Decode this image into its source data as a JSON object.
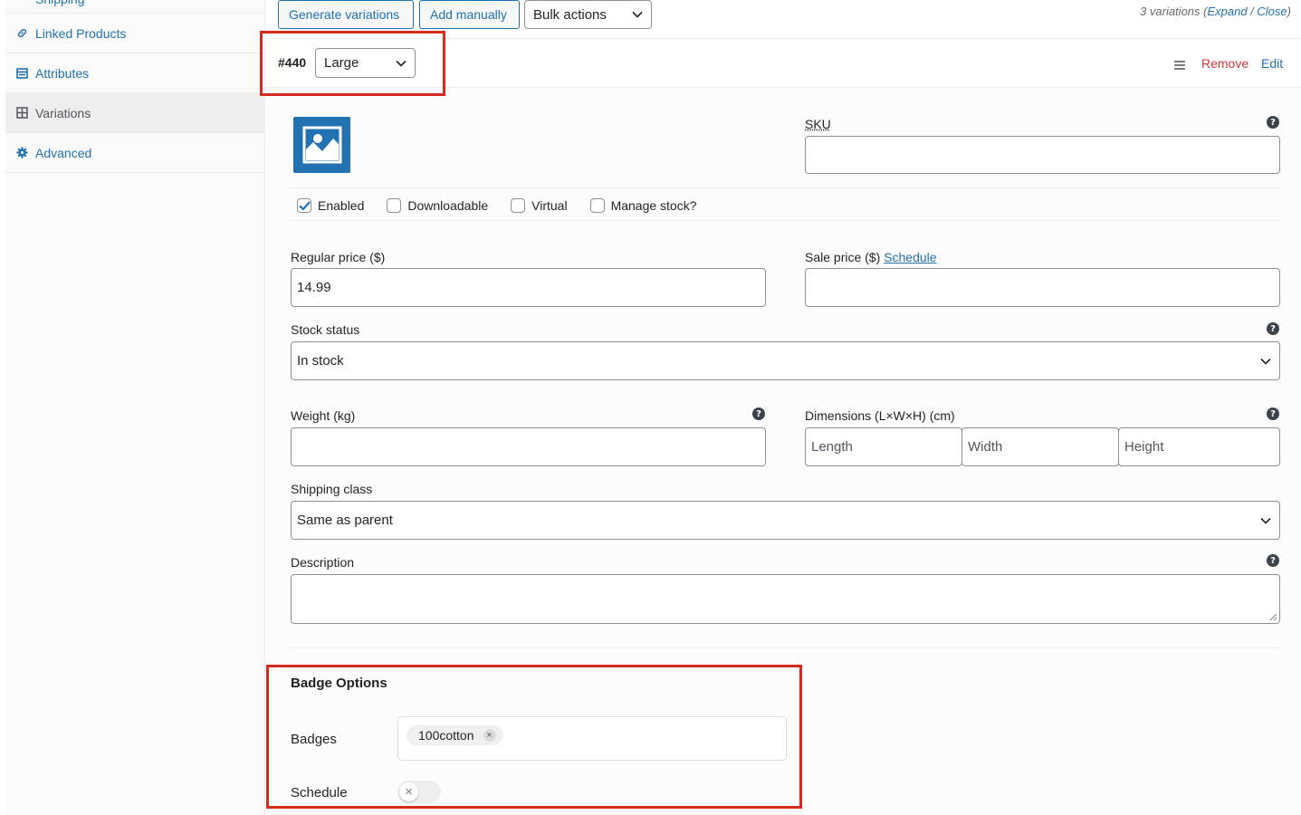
{
  "sidebar": {
    "items": [
      {
        "label": "Linked Products",
        "icon": "link-icon"
      },
      {
        "label": "Attributes",
        "icon": "list-icon"
      },
      {
        "label": "Variations",
        "icon": "grid-icon"
      },
      {
        "label": "Advanced",
        "icon": "gear-icon"
      }
    ]
  },
  "toolbar": {
    "generate_label": "Generate variations",
    "add_manually_label": "Add manually",
    "bulk_actions_label": "Bulk actions",
    "count_prefix": "3 variations (",
    "expand_label": "Expand",
    "divider": " / ",
    "close_label": "Close",
    "count_suffix": ")"
  },
  "variation": {
    "id": "#440",
    "attribute_value": "Large",
    "remove_label": "Remove",
    "edit_label": "Edit",
    "sku_label": "SKU",
    "sku_value": "",
    "checkboxes": [
      {
        "label": "Enabled",
        "checked": true
      },
      {
        "label": "Downloadable",
        "checked": false
      },
      {
        "label": "Virtual",
        "checked": false
      },
      {
        "label": "Manage stock?",
        "checked": false
      }
    ],
    "regular_price_label": "Regular price ($)",
    "regular_price_value": "14.99",
    "sale_price_label": "Sale price ($)",
    "schedule_link": "Schedule",
    "sale_price_value": "",
    "stock_status_label": "Stock status",
    "stock_status_value": "In stock",
    "weight_label": "Weight (kg)",
    "weight_value": "",
    "dimensions_label": "Dimensions (L×W×H) (cm)",
    "length_placeholder": "Length",
    "width_placeholder": "Width",
    "height_placeholder": "Height",
    "shipping_class_label": "Shipping class",
    "shipping_class_value": "Same as parent",
    "description_label": "Description",
    "description_value": ""
  },
  "badge_options": {
    "title": "Badge Options",
    "badges_label": "Badges",
    "badges": [
      "100cotton"
    ],
    "schedule_label": "Schedule",
    "schedule_enabled": false
  },
  "colors": {
    "accent": "#2271b1",
    "danger": "#d63638",
    "highlight": "#d52b1e"
  }
}
